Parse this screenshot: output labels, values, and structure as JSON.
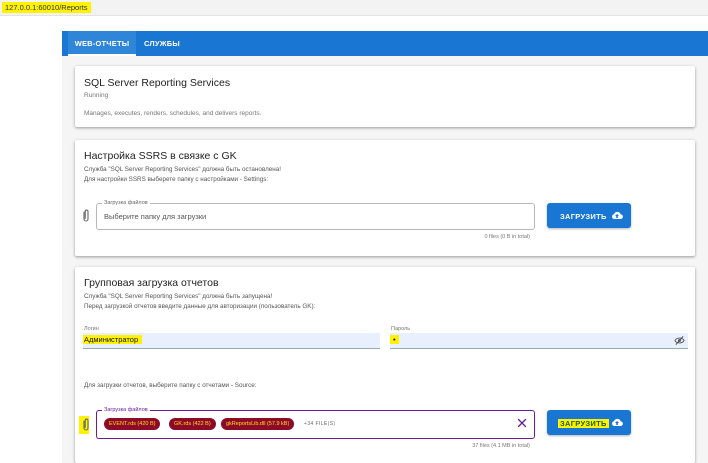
{
  "address": "127.0.0.1:60010/Reports",
  "tabs": [
    {
      "label": "WEB-ОТЧЕТЫ"
    },
    {
      "label": "СЛУЖБЫ"
    }
  ],
  "service": {
    "title": "SQL Server Reporting Services",
    "status": "Running",
    "description": "Manages, executes, renders, schedules, and delivers reports."
  },
  "setup": {
    "title": "Настройка SSRS в связке с GK",
    "line1": "Служба \"SQL Server Reporting Services\" должна быть остановлена!",
    "line2": "Для настройки SSRS выберете папку с настройками - Settings:",
    "field_label": "Загрузка файлов",
    "placeholder": "Выберите папку для загрузки",
    "button": "ЗАГРУЗИТЬ",
    "files_stat": "0 files (0 B in total)"
  },
  "batch": {
    "title": "Групповая загрузка отчетов",
    "line1": "Служба \"SQL Server Reporting Services\" должна быть запущена!",
    "line2": "Перед загрузкой отчетов введите данные для авторизации (пользователь GK):",
    "login_label": "Логин",
    "login_value": "Администратор",
    "password_label": "Пароль",
    "password_value": "•",
    "folder_hint": "Для загрузки отчетов, выберите папку с отчетами - Source:",
    "field_label": "Загрузка файлов",
    "chips": [
      "EVENT.rds (420 B)",
      "GK.rds (422 B)",
      "gkReportsLib.dll (57.9 kB)"
    ],
    "more": "+34 FILE(S)",
    "button": "ЗАГРУЗИТЬ",
    "files_stat": "37 files (4.1 MB in total)"
  },
  "colors": {
    "primary": "#1976d2",
    "highlight": "#fff200",
    "chip_bg": "#8e0a2b",
    "focus_border": "#6a1b9a"
  }
}
